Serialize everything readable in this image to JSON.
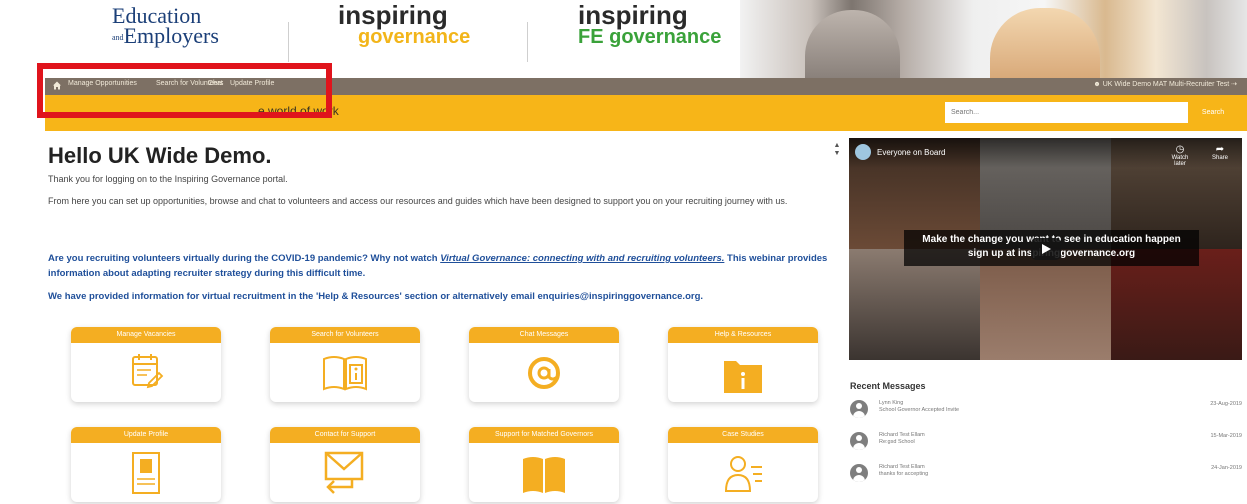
{
  "header": {
    "logo_ee_line1": "Education",
    "logo_ee_and": "and",
    "logo_ee_line2": "Employers",
    "logo_ig_line1": "inspiring",
    "logo_ig_line2": "governance",
    "logo_fe_line1": "inspiring",
    "logo_fe_line2": "FE governance"
  },
  "nav": {
    "items": [
      "Manage Opportunities",
      "Search for Volunteers",
      "Chat",
      "Update Profile"
    ],
    "user": "UK Wide Demo MAT Multi-Recruiter Test"
  },
  "strap": {
    "text": "e world of work"
  },
  "search": {
    "placeholder": "Search...",
    "button": "Search"
  },
  "main": {
    "greeting": "Hello UK Wide Demo.",
    "thanks": "Thank you for logging on to the Inspiring Governance portal.",
    "intro": "From here you can set up opportunities, browse and chat to volunteers and access our resources and guides which have been designed to support you on your recruiting journey with us.",
    "covid_before": "Are you recruiting volunteers virtually during the COVID-19 pandemic? Why not watch ",
    "covid_link": "Virtual Governance: connecting with and recruiting volunteers.",
    "covid_after": " This webinar provides information about adapting recruiter strategy during this difficult time.",
    "virtual": "We have provided information for virtual recruitment in the 'Help & Resources' section or alternatively email enquiries@inspiringgovernance.org."
  },
  "cards": [
    {
      "label": "Manage Vacancies",
      "icon": "calendar-edit-icon"
    },
    {
      "label": "Search for Volunteers",
      "icon": "book-info-icon"
    },
    {
      "label": "Chat Messages",
      "icon": "at-sign-icon"
    },
    {
      "label": "Help & Resources",
      "icon": "folder-info-icon"
    },
    {
      "label": "Update Profile",
      "icon": "profile-document-icon"
    },
    {
      "label": "Contact for Support",
      "icon": "envelope-reply-icon"
    },
    {
      "label": "Support for Matched Governors",
      "icon": "open-book-icon"
    },
    {
      "label": "Case Studies",
      "icon": "person-list-icon"
    }
  ],
  "video": {
    "title": "Everyone on Board",
    "watch_later": "Watch later",
    "share": "Share",
    "banner_line1": "Make the change you want to see in education happen",
    "banner_line2": "sign up at inspiringgovernance.org"
  },
  "recent": {
    "title": "Recent Messages",
    "messages": [
      {
        "name": "Lynn King",
        "text": "School Governor Accepted Invite",
        "date": "23-Aug-2019"
      },
      {
        "name": "Richard Test Ellam",
        "text": "Re:gsd School",
        "date": "15-Mar-2019"
      },
      {
        "name": "Richard Test Ellam",
        "text": "thanks for accepting",
        "date": "24-Jan-2019"
      }
    ]
  },
  "colors": {
    "accent": "#f7b518",
    "card_header": "#f4ae22",
    "nav": "#7d7064",
    "link_blue": "#1f4f9a",
    "highlight_red": "#e0141c"
  }
}
